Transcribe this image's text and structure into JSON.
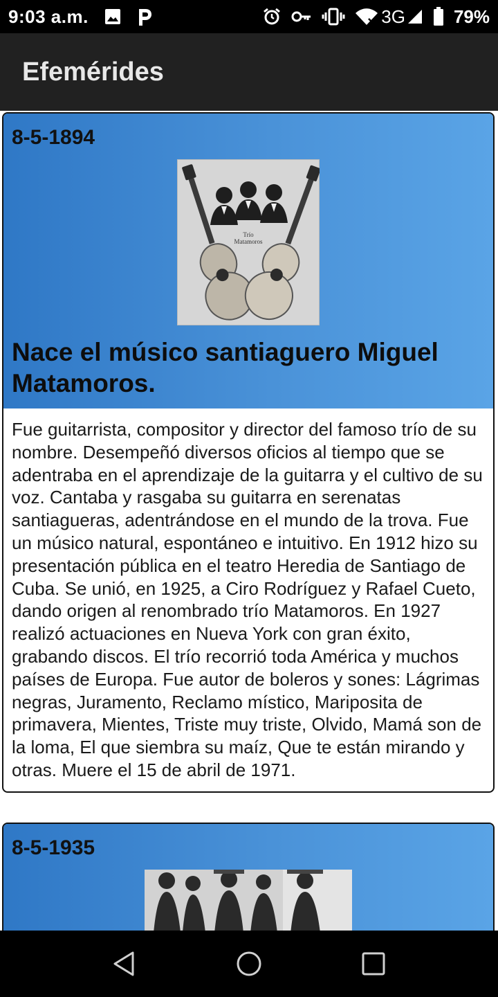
{
  "status_bar": {
    "time": "9:03 a.m.",
    "notification_icons": [
      "image-icon",
      "p-app-icon"
    ],
    "system_icons": [
      "alarm-icon",
      "key-icon",
      "vibrate-icon",
      "wifi-icon",
      "signal-icon",
      "battery-icon"
    ],
    "network": "3G",
    "battery": "79%"
  },
  "app_bar": {
    "title": "Efemérides"
  },
  "cards": [
    {
      "date": "8-5-1894",
      "image_caption": "Trío Matamoros",
      "title": "Nace el músico santiaguero Miguel Matamoros.",
      "body": "Fue guitarrista, compositor y director del famoso trío de su nombre. Desempeñó diversos oficios al tiempo que se adentraba en el aprendizaje de la guitarra y el cultivo de su voz. Cantaba y rasgaba su guitarra en serenatas santiagueras, adentrándose en el mundo de la trova. Fue un músico natural, espontáneo e intuitivo. En 1912 hizo su presentación pública en el teatro Heredia de Santiago de Cuba. Se unió, en 1925, a Ciro Rodríguez y Rafael Cueto, dando origen al renombrado trío Matamoros. En 1927 realizó actuaciones en Nueva York con gran éxito, grabando discos. El trío recorrió toda América y muchos países de Europa. Fue autor de boleros y sones: Lágrimas negras, Juramento, Reclamo místico, Mariposita de primavera, Mientes, Triste muy triste, Olvido, Mamá son de la loma, El que siembra su maíz, Que te están mirando y otras. Muere el 15 de abril de 1971."
    },
    {
      "date": "8-5-1935"
    }
  ],
  "nav_bar": {
    "buttons": [
      "back-icon",
      "home-icon",
      "recents-icon"
    ]
  }
}
